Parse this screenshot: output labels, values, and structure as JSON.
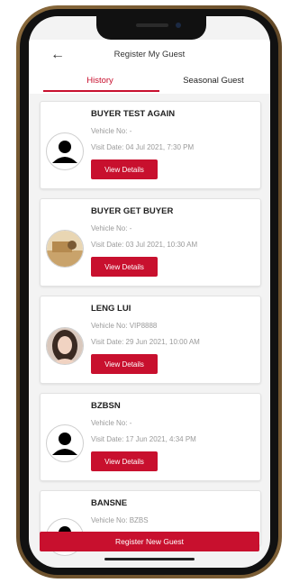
{
  "header": {
    "title": "Register My Guest"
  },
  "tabs": [
    {
      "label": "History",
      "active": true
    },
    {
      "label": "Seasonal Guest",
      "active": false
    }
  ],
  "guests": [
    {
      "name": "BUYER TEST AGAIN",
      "vehicle": "Vehicle No: -",
      "visit": "Visit Date: 04 Jul 2021, 7:30 PM",
      "action": "View Details",
      "avatar": "default-user-icon"
    },
    {
      "name": "BUYER GET BUYER",
      "vehicle": "Vehicle No: -",
      "visit": "Visit Date: 03 Jul 2021, 10:30 AM",
      "action": "View Details",
      "avatar": "photo"
    },
    {
      "name": "LENG LUI",
      "vehicle": "Vehicle No: VIP8888",
      "visit": "Visit Date: 29 Jun 2021, 10:00 AM",
      "action": "View Details",
      "avatar": "photo"
    },
    {
      "name": "BZBSN",
      "vehicle": "Vehicle No: -",
      "visit": "Visit Date: 17 Jun 2021, 4:34 PM",
      "action": "View Details",
      "avatar": "default-user-icon"
    },
    {
      "name": "BANSNE",
      "vehicle": "Vehicle No: BZBS",
      "visit": "",
      "action": "",
      "avatar": "default-user-icon"
    }
  ],
  "footer": {
    "register_label": "Register New Guest"
  },
  "colors": {
    "accent": "#c8102e",
    "frame": "#6b4f2c"
  }
}
